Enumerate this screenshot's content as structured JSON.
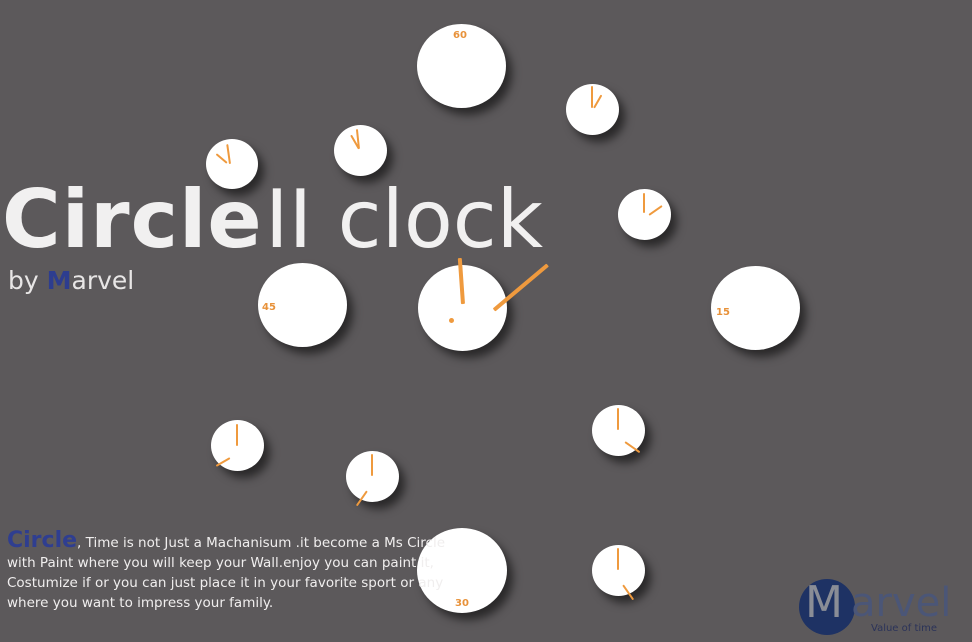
{
  "title": {
    "main": "Circle",
    "rest": "II clock"
  },
  "byline": {
    "prefix": "by ",
    "brand_m": "M",
    "brand_rest": "arvel"
  },
  "clock_numbers": {
    "top": "60",
    "right": "15",
    "bottom": "30",
    "left": "45"
  },
  "description": {
    "lead": "Circle",
    "body": ", Time is not Just a Machanisum .it become a Ms Circle with Paint where you will keep your Wall.enjoy you can paint it, Costumize if or you can just place it in your favorite sport or any where you want to impress your family."
  },
  "logo": {
    "m": "M",
    "rest": "arvel",
    "tagline": "Value of time"
  },
  "colors": {
    "background": "#5c595b",
    "accent": "#ef9a3e",
    "brand_blue": "#2d3d8f"
  }
}
